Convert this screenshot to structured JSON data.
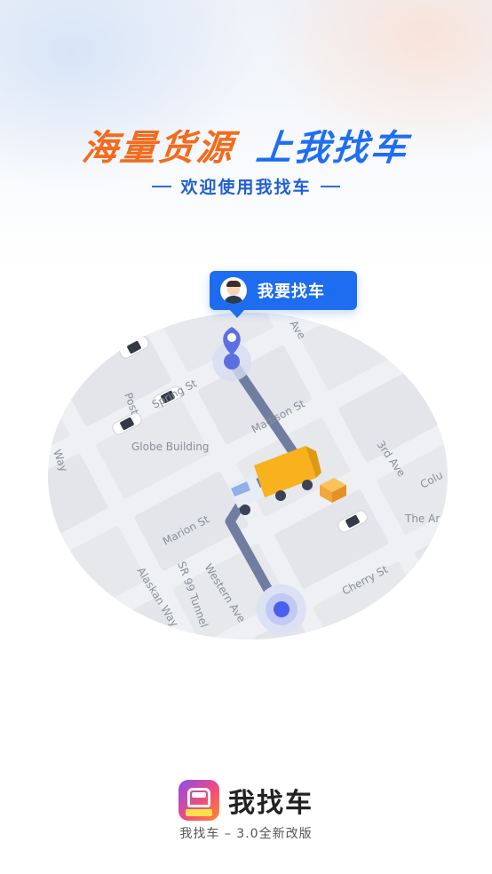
{
  "hero": {
    "headline_left": "海量货源",
    "headline_right": "上我找车",
    "subtitle": "欢迎使用我找车"
  },
  "map": {
    "pin_label": "我要找车",
    "street_labels": {
      "s1": "Spring St",
      "s2": "Madison St",
      "s3": "Globe Building",
      "s4": "3rd Ave",
      "s5": "Colu",
      "s6": "The Ar",
      "s7": "Marion St",
      "s8": "SR 99 Tunnel",
      "s9": "Alaskan Way",
      "s10": "Western Ave",
      "s11": "Cherry St",
      "s12": "Way",
      "s13": "Post",
      "s14": "Ave"
    },
    "route_color": "#6f7ea0",
    "start_pin_color": "#5b6fe0",
    "end_pin_color": "#4a5ef0",
    "truck_color": "#f7b21d"
  },
  "brand": {
    "name": "我找车",
    "version": "我找车 – 3.0全新改版"
  },
  "colors": {
    "accent_orange": "#f36b1c",
    "accent_blue": "#1f6ef2"
  }
}
